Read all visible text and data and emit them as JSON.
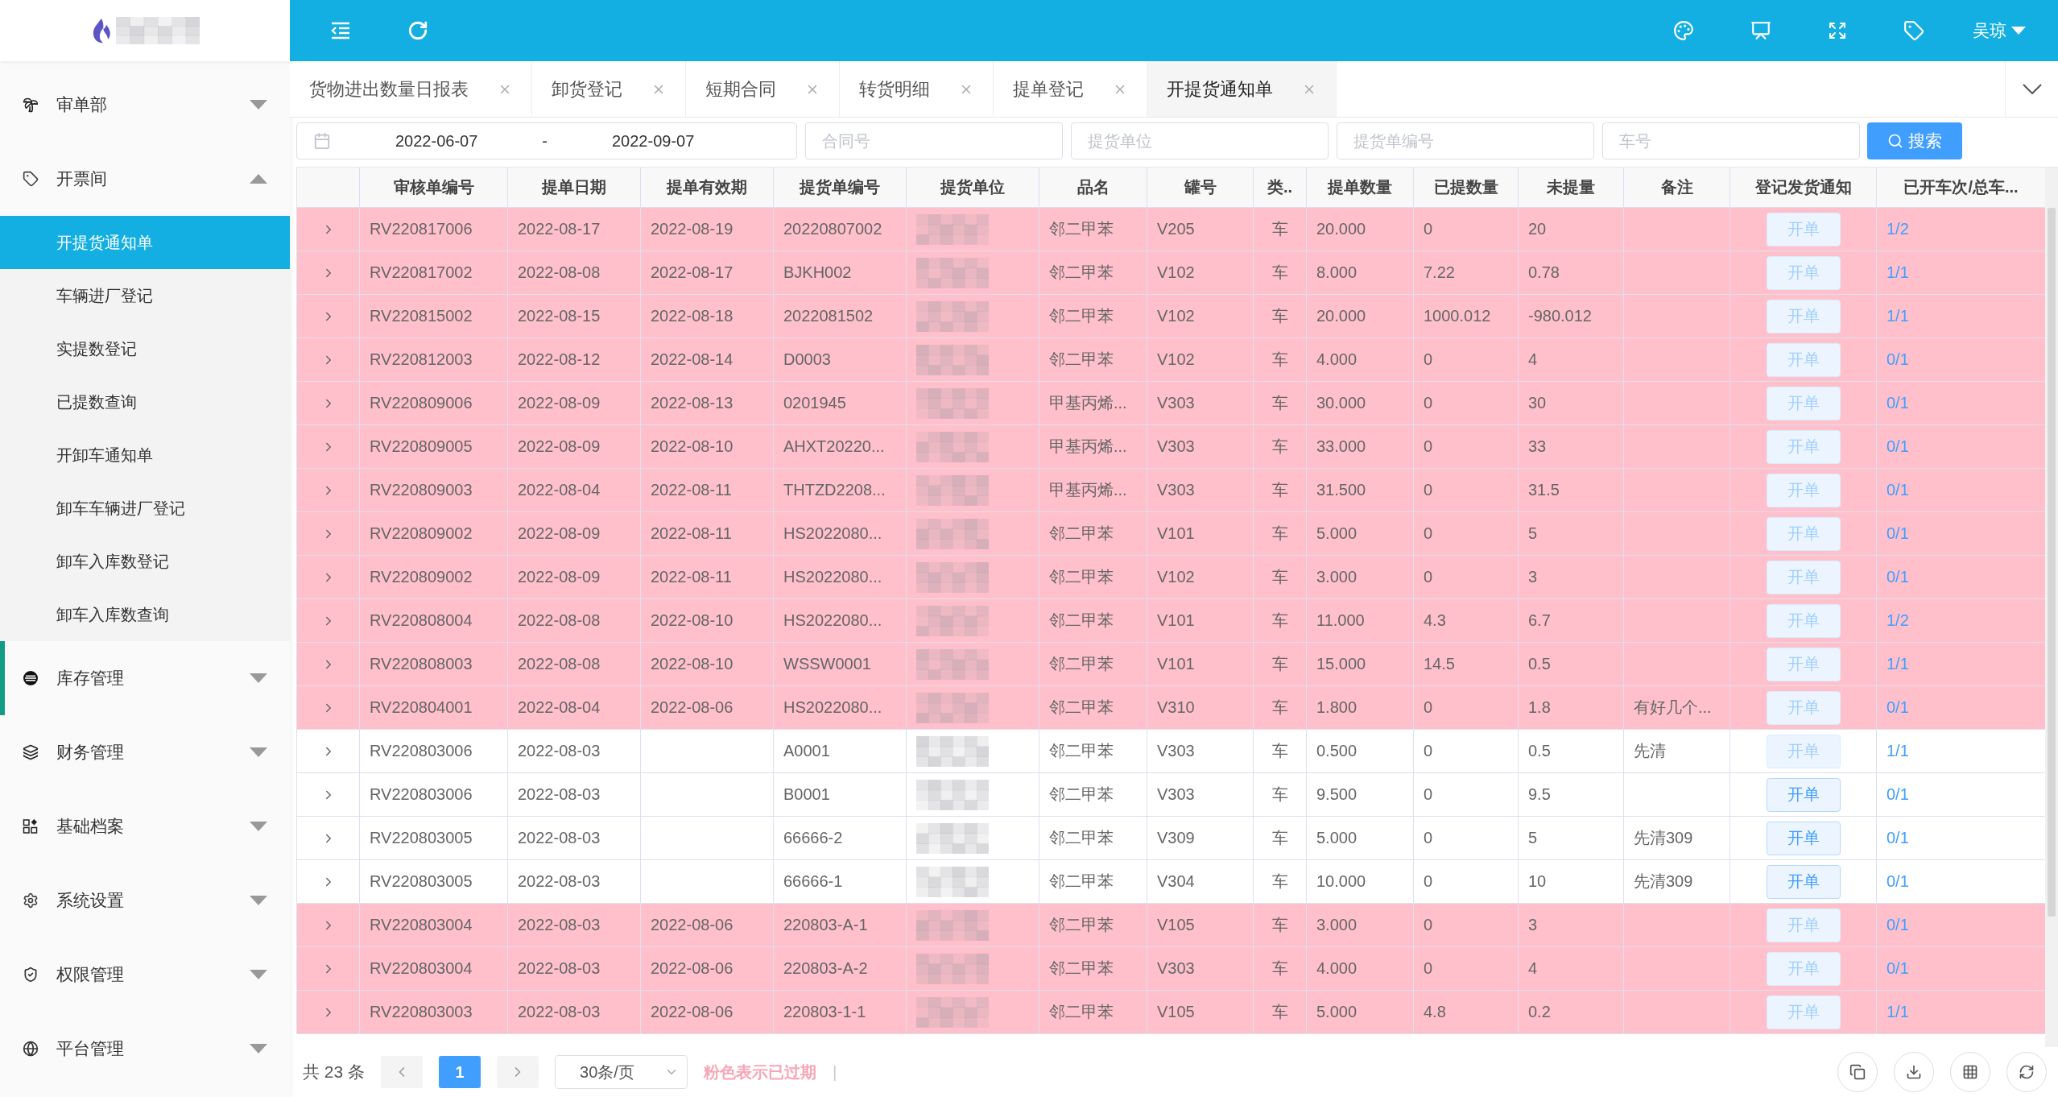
{
  "sidebar": {
    "sections": [
      {
        "label": "审单部",
        "expanded": false,
        "highlighted": false
      },
      {
        "label": "开票间",
        "expanded": true,
        "highlighted": false,
        "children": [
          {
            "label": "开提货通知单",
            "selected": true
          },
          {
            "label": "车辆进厂登记",
            "selected": false
          },
          {
            "label": "实提数登记",
            "selected": false
          },
          {
            "label": "已提数查询",
            "selected": false
          },
          {
            "label": "开卸车通知单",
            "selected": false
          },
          {
            "label": "卸车车辆进厂登记",
            "selected": false
          },
          {
            "label": "卸车入库数登记",
            "selected": false
          },
          {
            "label": "卸车入库数查询",
            "selected": false
          }
        ]
      },
      {
        "label": "库存管理",
        "expanded": false,
        "highlighted": true
      },
      {
        "label": "财务管理",
        "expanded": false,
        "highlighted": false
      },
      {
        "label": "基础档案",
        "expanded": false,
        "highlighted": false
      },
      {
        "label": "系统设置",
        "expanded": false,
        "highlighted": false
      },
      {
        "label": "权限管理",
        "expanded": false,
        "highlighted": false
      },
      {
        "label": "平台管理",
        "expanded": false,
        "highlighted": false
      }
    ]
  },
  "toolbar": {
    "user": "吴琼"
  },
  "tabs": [
    {
      "label": "货物进出数量日报表",
      "selected": false
    },
    {
      "label": "卸货登记",
      "selected": false
    },
    {
      "label": "短期合同",
      "selected": false
    },
    {
      "label": "转货明细",
      "selected": false
    },
    {
      "label": "提单登记",
      "selected": false
    },
    {
      "label": "开提货通知单",
      "selected": true
    }
  ],
  "filters": {
    "date_start": "2022-06-07",
    "date_separator": "-",
    "date_end": "2022-09-07",
    "fields": [
      {
        "placeholder": "合同号"
      },
      {
        "placeholder": "提货单位"
      },
      {
        "placeholder": "提货单编号"
      },
      {
        "placeholder": "车号"
      }
    ],
    "search_button": "搜索"
  },
  "table": {
    "columns": [
      "审核单编号",
      "提单日期",
      "提单有效期",
      "提货单编号",
      "提货单位",
      "品名",
      "罐号",
      "类..",
      "提单数量",
      "已提数量",
      "未提量",
      "备注",
      "登记发货通知",
      "已开车次/总车..."
    ],
    "rows": [
      {
        "audit_no": "RV220817006",
        "bill_date": "2022-08-17",
        "valid_until": "2022-08-19",
        "pickup_no": "20220807002",
        "product": "邻二甲苯",
        "tank": "V205",
        "type": "车",
        "bill_qty": "20.000",
        "picked_qty": "0",
        "remaining_qty": "20",
        "action": "开单",
        "action_disabled": true,
        "trips": "1/2",
        "expired": true
      },
      {
        "audit_no": "RV220817002",
        "bill_date": "2022-08-08",
        "valid_until": "2022-08-17",
        "pickup_no": "BJKH002",
        "product": "邻二甲苯",
        "tank": "V102",
        "type": "车",
        "bill_qty": "8.000",
        "picked_qty": "7.22",
        "remaining_qty": "0.78",
        "action": "开单",
        "action_disabled": true,
        "trips": "1/1",
        "expired": true
      },
      {
        "audit_no": "RV220815002",
        "bill_date": "2022-08-15",
        "valid_until": "2022-08-18",
        "pickup_no": "2022081502",
        "product": "邻二甲苯",
        "tank": "V102",
        "type": "车",
        "bill_qty": "20.000",
        "picked_qty": "1000.012",
        "remaining_qty": "-980.012",
        "action": "开单",
        "action_disabled": true,
        "trips": "1/1",
        "expired": true
      },
      {
        "audit_no": "RV220812003",
        "bill_date": "2022-08-12",
        "valid_until": "2022-08-14",
        "pickup_no": "D0003",
        "product": "邻二甲苯",
        "tank": "V102",
        "type": "车",
        "bill_qty": "4.000",
        "picked_qty": "0",
        "remaining_qty": "4",
        "action": "开单",
        "action_disabled": true,
        "trips": "0/1",
        "expired": true
      },
      {
        "audit_no": "RV220809006",
        "bill_date": "2022-08-09",
        "valid_until": "2022-08-13",
        "pickup_no": "0201945",
        "product": "甲基丙烯...",
        "tank": "V303",
        "type": "车",
        "bill_qty": "30.000",
        "picked_qty": "0",
        "remaining_qty": "30",
        "action": "开单",
        "action_disabled": true,
        "trips": "0/1",
        "expired": true
      },
      {
        "audit_no": "RV220809005",
        "bill_date": "2022-08-09",
        "valid_until": "2022-08-10",
        "pickup_no": "AHXT20220...",
        "product": "甲基丙烯...",
        "tank": "V303",
        "type": "车",
        "bill_qty": "33.000",
        "picked_qty": "0",
        "remaining_qty": "33",
        "action": "开单",
        "action_disabled": true,
        "trips": "0/1",
        "expired": true
      },
      {
        "audit_no": "RV220809003",
        "bill_date": "2022-08-04",
        "valid_until": "2022-08-11",
        "pickup_no": "THTZD2208...",
        "product": "甲基丙烯...",
        "tank": "V303",
        "type": "车",
        "bill_qty": "31.500",
        "picked_qty": "0",
        "remaining_qty": "31.5",
        "action": "开单",
        "action_disabled": true,
        "trips": "0/1",
        "expired": true
      },
      {
        "audit_no": "RV220809002",
        "bill_date": "2022-08-09",
        "valid_until": "2022-08-11",
        "pickup_no": "HS2022080...",
        "product": "邻二甲苯",
        "tank": "V101",
        "type": "车",
        "bill_qty": "5.000",
        "picked_qty": "0",
        "remaining_qty": "5",
        "action": "开单",
        "action_disabled": true,
        "trips": "0/1",
        "expired": true
      },
      {
        "audit_no": "RV220809002",
        "bill_date": "2022-08-09",
        "valid_until": "2022-08-11",
        "pickup_no": "HS2022080...",
        "product": "邻二甲苯",
        "tank": "V102",
        "type": "车",
        "bill_qty": "3.000",
        "picked_qty": "0",
        "remaining_qty": "3",
        "action": "开单",
        "action_disabled": true,
        "trips": "0/1",
        "expired": true
      },
      {
        "audit_no": "RV220808004",
        "bill_date": "2022-08-08",
        "valid_until": "2022-08-10",
        "pickup_no": "HS2022080...",
        "product": "邻二甲苯",
        "tank": "V101",
        "type": "车",
        "bill_qty": "11.000",
        "picked_qty": "4.3",
        "remaining_qty": "6.7",
        "action": "开单",
        "action_disabled": true,
        "trips": "1/2",
        "expired": true
      },
      {
        "audit_no": "RV220808003",
        "bill_date": "2022-08-08",
        "valid_until": "2022-08-10",
        "pickup_no": "WSSW0001",
        "product": "邻二甲苯",
        "tank": "V101",
        "type": "车",
        "bill_qty": "15.000",
        "picked_qty": "14.5",
        "remaining_qty": "0.5",
        "action": "开单",
        "action_disabled": true,
        "trips": "1/1",
        "expired": true
      },
      {
        "audit_no": "RV220804001",
        "bill_date": "2022-08-04",
        "valid_until": "2022-08-06",
        "pickup_no": "HS2022080...",
        "product": "邻二甲苯",
        "tank": "V310",
        "type": "车",
        "bill_qty": "1.800",
        "picked_qty": "0",
        "remaining_qty": "1.8",
        "remark": "有好几个...",
        "action": "开单",
        "action_disabled": true,
        "trips": "0/1",
        "expired": true
      },
      {
        "audit_no": "RV220803006",
        "bill_date": "2022-08-03",
        "pickup_no": "A0001",
        "product": "邻二甲苯",
        "tank": "V303",
        "type": "车",
        "bill_qty": "0.500",
        "picked_qty": "0",
        "remaining_qty": "0.5",
        "remark": "先清",
        "action": "开单",
        "action_disabled": true,
        "trips": "1/1",
        "expired": false
      },
      {
        "audit_no": "RV220803006",
        "bill_date": "2022-08-03",
        "pickup_no": "B0001",
        "product": "邻二甲苯",
        "tank": "V303",
        "type": "车",
        "bill_qty": "9.500",
        "picked_qty": "0",
        "remaining_qty": "9.5",
        "action": "开单",
        "action_disabled": false,
        "trips": "0/1",
        "expired": false
      },
      {
        "audit_no": "RV220803005",
        "bill_date": "2022-08-03",
        "pickup_no": "66666-2",
        "product": "邻二甲苯",
        "tank": "V309",
        "type": "车",
        "bill_qty": "5.000",
        "picked_qty": "0",
        "remaining_qty": "5",
        "remark": "先清309",
        "action": "开单",
        "action_disabled": false,
        "trips": "0/1",
        "expired": false
      },
      {
        "audit_no": "RV220803005",
        "bill_date": "2022-08-03",
        "pickup_no": "66666-1",
        "product": "邻二甲苯",
        "tank": "V304",
        "type": "车",
        "bill_qty": "10.000",
        "picked_qty": "0",
        "remaining_qty": "10",
        "remark": "先清309",
        "action": "开单",
        "action_disabled": false,
        "trips": "0/1",
        "expired": false
      },
      {
        "audit_no": "RV220803004",
        "bill_date": "2022-08-03",
        "valid_until": "2022-08-06",
        "pickup_no": "220803-A-1",
        "product": "邻二甲苯",
        "tank": "V105",
        "type": "车",
        "bill_qty": "3.000",
        "picked_qty": "0",
        "remaining_qty": "3",
        "action": "开单",
        "action_disabled": true,
        "trips": "0/1",
        "expired": true
      },
      {
        "audit_no": "RV220803004",
        "bill_date": "2022-08-03",
        "valid_until": "2022-08-06",
        "pickup_no": "220803-A-2",
        "product": "邻二甲苯",
        "tank": "V303",
        "type": "车",
        "bill_qty": "4.000",
        "picked_qty": "0",
        "remaining_qty": "4",
        "action": "开单",
        "action_disabled": true,
        "trips": "0/1",
        "expired": true
      },
      {
        "audit_no": "RV220803003",
        "bill_date": "2022-08-03",
        "valid_until": "2022-08-06",
        "pickup_no": "220803-1-1",
        "product": "邻二甲苯",
        "tank": "V105",
        "type": "车",
        "bill_qty": "5.000",
        "picked_qty": "4.8",
        "remaining_qty": "0.2",
        "action": "开单",
        "action_disabled": true,
        "trips": "1/1",
        "expired": true
      }
    ]
  },
  "pagination": {
    "total": "共 23 条",
    "pages": [
      {
        "label": "1",
        "selected": true
      }
    ],
    "page_size": "30条/页",
    "legend": "粉色表示已过期",
    "separator": "|"
  }
}
